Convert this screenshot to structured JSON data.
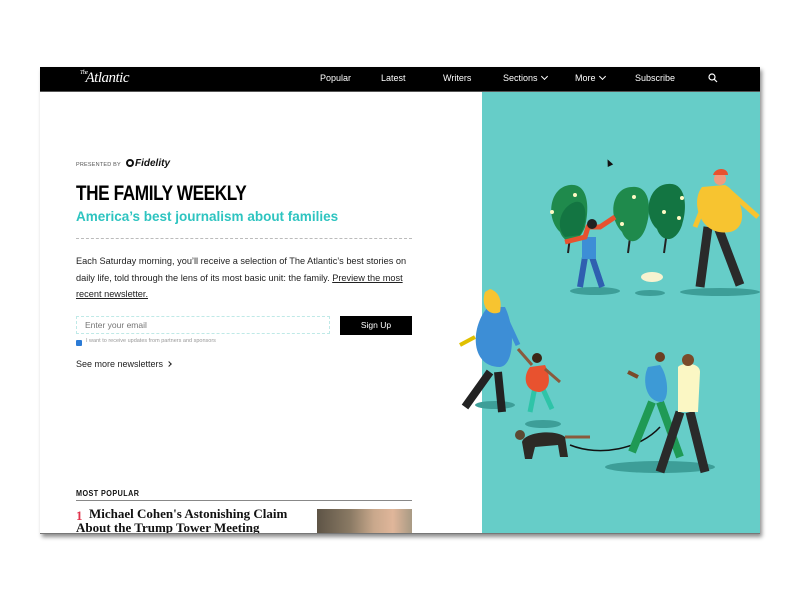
{
  "nav": {
    "logo": "Atlantic",
    "logo_prefix": "The",
    "items": [
      {
        "label": "Popular"
      },
      {
        "label": "Latest"
      },
      {
        "label": "Writers"
      },
      {
        "label": "Sections",
        "dropdown": true
      },
      {
        "label": "More",
        "dropdown": true
      },
      {
        "label": "Subscribe"
      }
    ],
    "search_icon": "search-icon"
  },
  "newsletter": {
    "presented_by": "PRESENTED BY",
    "sponsor": "Fidelity",
    "title": "THE FAMILY WEEKLY",
    "subtitle": "America’s best journalism about families",
    "description": "Each Saturday morning, you’ll receive a selection of The Atlantic’s best stories on daily life, told through the lens of its most basic unit: the family. ",
    "preview_link": "Preview the most recent newsletter.",
    "email_placeholder": "Enter your email",
    "email_value": "",
    "signup_label": "Sign Up",
    "checkbox_checked": true,
    "checkbox_label": "I want to receive updates from partners and sponsors",
    "see_more": "See more newsletters"
  },
  "most_popular": {
    "label": "MOST POPULAR",
    "items": [
      {
        "rank": "1",
        "title": "Michael Cohen's Astonishing Claim About the Trump Tower Meeting"
      }
    ]
  },
  "colors": {
    "accent": "#2ec4c0",
    "illustration_bg": "#66cdc8",
    "rank": "#e0334c",
    "navbar": "#000000"
  }
}
